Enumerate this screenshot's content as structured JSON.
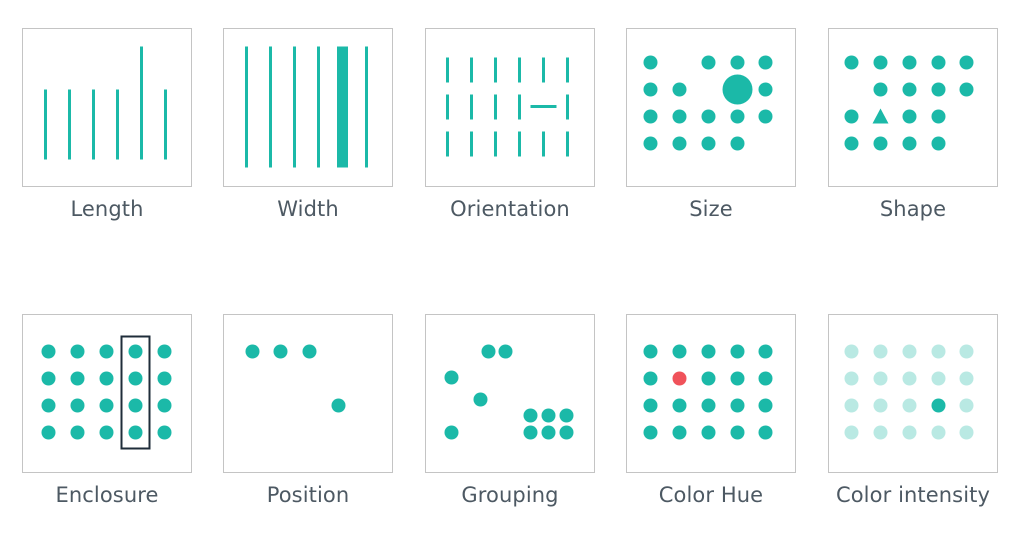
{
  "colors": {
    "teal": "#1bb9a8",
    "teal_light": "#b9e9e3",
    "red": "#f0525a",
    "enclosure": "#1f2d3a",
    "border": "#c4c4c4",
    "label": "#4d5963"
  },
  "panels": [
    {
      "id": "length",
      "label": "Length"
    },
    {
      "id": "width",
      "label": "Width"
    },
    {
      "id": "orientation",
      "label": "Orientation"
    },
    {
      "id": "size",
      "label": "Size"
    },
    {
      "id": "shape",
      "label": "Shape"
    },
    {
      "id": "enclosure",
      "label": "Enclosure"
    },
    {
      "id": "position",
      "label": "Position"
    },
    {
      "id": "grouping",
      "label": "Grouping"
    },
    {
      "id": "color-hue",
      "label": "Color Hue"
    },
    {
      "id": "color-intensity",
      "label": "Color intensity"
    }
  ]
}
